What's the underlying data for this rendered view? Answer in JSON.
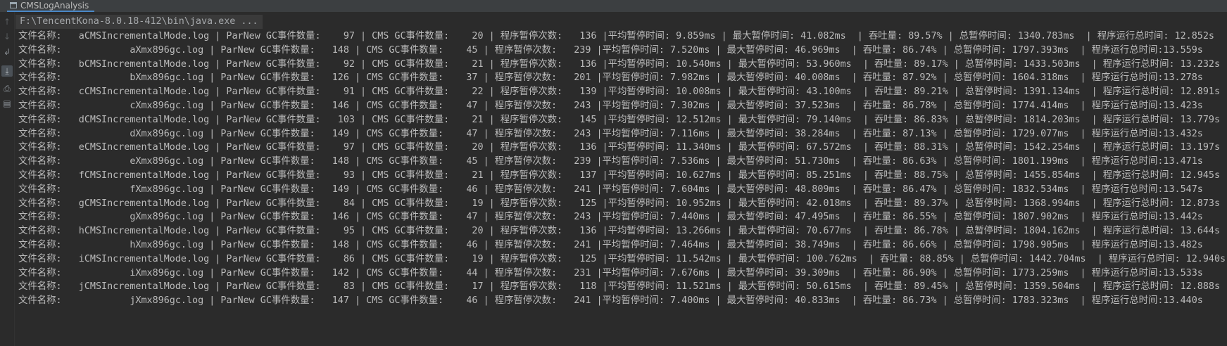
{
  "tab": {
    "icon": "console-tab-icon",
    "label": "CMSLogAnalysis"
  },
  "toolbar_icons": [
    "arrow-up-icon",
    "arrow-down-icon",
    "soft-wrap-icon",
    "scroll-to-end-icon",
    "print-icon",
    "trash-icon"
  ],
  "console": {
    "command_line": "F:\\TencentKona-8.0.18-412\\bin\\java.exe ...",
    "lines": [
      "文件名称:   aCMSIncrementalMode.log | ParNew GC事件数量:    97 | CMS GC事件数量:    20 | 程序暂停次数:   136 |平均暂停时间: 9.859ms | 最大暂停时间: 41.082ms  | 吞吐量: 89.57% | 总暂停时间: 1340.783ms  | 程序运行总时间: 12.852s",
      "文件名称:            aXmx896gc.log | ParNew GC事件数量:   148 | CMS GC事件数量:    45 | 程序暂停次数:   239 |平均暂停时间: 7.520ms | 最大暂停时间: 46.969ms  | 吞吐量: 86.74% | 总暂停时间: 1797.393ms  | 程序运行总时间:13.559s",
      "文件名称:   bCMSIncrementalMode.log | ParNew GC事件数量:    92 | CMS GC事件数量:    21 | 程序暂停次数:   136 |平均暂停时间: 10.540ms | 最大暂停时间: 53.960ms  | 吞吐量: 89.17% | 总暂停时间: 1433.503ms  | 程序运行总时间: 13.232s",
      "文件名称:            bXmx896gc.log | ParNew GC事件数量:   126 | CMS GC事件数量:    37 | 程序暂停次数:   201 |平均暂停时间: 7.982ms | 最大暂停时间: 40.008ms  | 吞吐量: 87.92% | 总暂停时间: 1604.318ms  | 程序运行总时间:13.278s",
      "文件名称:   cCMSIncrementalMode.log | ParNew GC事件数量:    91 | CMS GC事件数量:    22 | 程序暂停次数:   139 |平均暂停时间: 10.008ms | 最大暂停时间: 43.100ms  | 吞吐量: 89.21% | 总暂停时间: 1391.134ms  | 程序运行总时间: 12.891s",
      "文件名称:            cXmx896gc.log | ParNew GC事件数量:   146 | CMS GC事件数量:    47 | 程序暂停次数:   243 |平均暂停时间: 7.302ms | 最大暂停时间: 37.523ms  | 吞吐量: 86.78% | 总暂停时间: 1774.414ms  | 程序运行总时间:13.423s",
      "文件名称:   dCMSIncrementalMode.log | ParNew GC事件数量:   103 | CMS GC事件数量:    21 | 程序暂停次数:   145 |平均暂停时间: 12.512ms | 最大暂停时间: 79.140ms  | 吞吐量: 86.83% | 总暂停时间: 1814.203ms  | 程序运行总时间: 13.779s",
      "文件名称:            dXmx896gc.log | ParNew GC事件数量:   149 | CMS GC事件数量:    47 | 程序暂停次数:   243 |平均暂停时间: 7.116ms | 最大暂停时间: 38.284ms  | 吞吐量: 87.13% | 总暂停时间: 1729.077ms  | 程序运行总时间:13.432s",
      "文件名称:   eCMSIncrementalMode.log | ParNew GC事件数量:    97 | CMS GC事件数量:    20 | 程序暂停次数:   136 |平均暂停时间: 11.340ms | 最大暂停时间: 67.572ms  | 吞吐量: 88.31% | 总暂停时间: 1542.254ms  | 程序运行总时间: 13.197s",
      "文件名称:            eXmx896gc.log | ParNew GC事件数量:   148 | CMS GC事件数量:    45 | 程序暂停次数:   239 |平均暂停时间: 7.536ms | 最大暂停时间: 51.730ms  | 吞吐量: 86.63% | 总暂停时间: 1801.199ms  | 程序运行总时间:13.471s",
      "文件名称:   fCMSIncrementalMode.log | ParNew GC事件数量:    93 | CMS GC事件数量:    21 | 程序暂停次数:   137 |平均暂停时间: 10.627ms | 最大暂停时间: 85.251ms  | 吞吐量: 88.75% | 总暂停时间: 1455.854ms  | 程序运行总时间: 12.945s",
      "文件名称:            fXmx896gc.log | ParNew GC事件数量:   149 | CMS GC事件数量:    46 | 程序暂停次数:   241 |平均暂停时间: 7.604ms | 最大暂停时间: 48.809ms  | 吞吐量: 86.47% | 总暂停时间: 1832.534ms  | 程序运行总时间:13.547s",
      "文件名称:   gCMSIncrementalMode.log | ParNew GC事件数量:    84 | CMS GC事件数量:    19 | 程序暂停次数:   125 |平均暂停时间: 10.952ms | 最大暂停时间: 42.018ms  | 吞吐量: 89.37% | 总暂停时间: 1368.994ms  | 程序运行总时间: 12.873s",
      "文件名称:            gXmx896gc.log | ParNew GC事件数量:   146 | CMS GC事件数量:    47 | 程序暂停次数:   243 |平均暂停时间: 7.440ms | 最大暂停时间: 47.495ms  | 吞吐量: 86.55% | 总暂停时间: 1807.902ms  | 程序运行总时间:13.442s",
      "文件名称:   hCMSIncrementalMode.log | ParNew GC事件数量:    95 | CMS GC事件数量:    20 | 程序暂停次数:   136 |平均暂停时间: 13.266ms | 最大暂停时间: 70.677ms  | 吞吐量: 86.78% | 总暂停时间: 1804.162ms  | 程序运行总时间: 13.644s",
      "文件名称:            hXmx896gc.log | ParNew GC事件数量:   148 | CMS GC事件数量:    46 | 程序暂停次数:   241 |平均暂停时间: 7.464ms | 最大暂停时间: 38.749ms  | 吞吐量: 86.66% | 总暂停时间: 1798.905ms  | 程序运行总时间:13.482s",
      "文件名称:   iCMSIncrementalMode.log | ParNew GC事件数量:    86 | CMS GC事件数量:    19 | 程序暂停次数:   125 |平均暂停时间: 11.542ms | 最大暂停时间: 100.762ms  | 吞吐量: 88.85% | 总暂停时间: 1442.704ms  | 程序运行总时间: 12.940s",
      "文件名称:            iXmx896gc.log | ParNew GC事件数量:   142 | CMS GC事件数量:    44 | 程序暂停次数:   231 |平均暂停时间: 7.676ms | 最大暂停时间: 39.309ms  | 吞吐量: 86.90% | 总暂停时间: 1773.259ms  | 程序运行总时间:13.533s",
      "文件名称:   jCMSIncrementalMode.log | ParNew GC事件数量:    83 | CMS GC事件数量:    17 | 程序暂停次数:   118 |平均暂停时间: 11.521ms | 最大暂停时间: 50.615ms  | 吞吐量: 89.45% | 总暂停时间: 1359.504ms  | 程序运行总时间: 12.888s",
      "文件名称:            jXmx896gc.log | ParNew GC事件数量:   147 | CMS GC事件数量:    46 | 程序暂停次数:   241 |平均暂停时间: 7.400ms | 最大暂停时间: 40.833ms  | 吞吐量: 86.73% | 总暂停时间: 1783.323ms  | 程序运行总时间:13.440s"
    ]
  }
}
